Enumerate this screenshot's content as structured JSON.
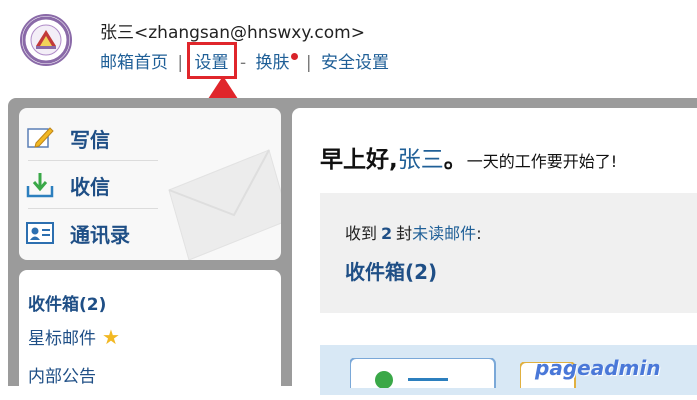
{
  "header": {
    "user": "张三<zhangsan@hnswxy.com>",
    "nav": {
      "home": "邮箱首页",
      "sep1": "|",
      "settings": "设置",
      "sep2": "-",
      "skin": "换肤",
      "sep3": "|",
      "security": "安全设置"
    }
  },
  "compose": {
    "write": "写信",
    "receive": "收信",
    "contacts": "通讯录"
  },
  "folders": {
    "inbox": "收件箱(2)",
    "starred": "星标邮件",
    "notice": "内部公告"
  },
  "main": {
    "greeting": "早上好,",
    "name": "张三",
    "period": "。",
    "tagline": "一天的工作要开始了!",
    "unread_prefix": "收到",
    "unread_count": "2",
    "unread_unit": "封",
    "unread_link": "未读邮件",
    "unread_colon": ":",
    "inbox_link": "收件箱(2)"
  },
  "watermark": "pageadmin",
  "colors": {
    "link": "#1f5f97",
    "highlight": "#e0262b",
    "workspace": "#9b9b9b"
  }
}
